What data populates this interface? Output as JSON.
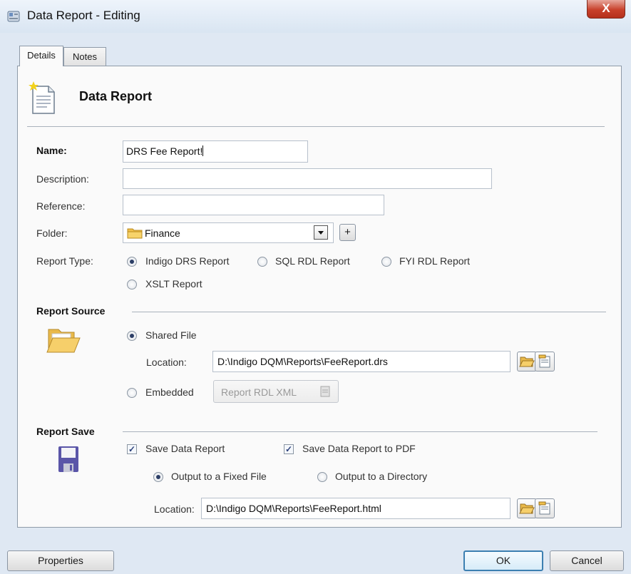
{
  "window": {
    "title": "Data Report - Editing",
    "close_glyph": "X"
  },
  "tabs": [
    {
      "label": "Details"
    },
    {
      "label": "Notes"
    }
  ],
  "header": {
    "title": "Data Report"
  },
  "fields": {
    "name_label": "Name:",
    "name_value": "DRS Fee Report!",
    "description_label": "Description:",
    "description_value": "",
    "reference_label": "Reference:",
    "reference_value": "",
    "folder_label": "Folder:",
    "folder_value": "Finance",
    "folder_add_label": "+"
  },
  "report_type": {
    "label": "Report Type:",
    "selected": "Indigo DRS Report",
    "options": [
      "Indigo DRS Report",
      "SQL RDL Report",
      "FYI RDL Report",
      "XSLT Report"
    ]
  },
  "report_source": {
    "title": "Report Source",
    "shared_file_label": "Shared File",
    "location_label": "Location:",
    "location_value": "D:\\Indigo DQM\\Reports\\FeeReport.drs",
    "embedded_label": "Embedded",
    "rdl_button_label": "Report RDL XML",
    "selected": "Shared File"
  },
  "report_save": {
    "title": "Report Save",
    "save_data_report_label": "Save Data Report",
    "save_data_report_checked": true,
    "save_pdf_label": "Save Data Report to PDF",
    "save_pdf_checked": true,
    "output_fixed_label": "Output to a Fixed File",
    "output_directory_label": "Output to a Directory",
    "output_selected": "Output to a Fixed File",
    "location_label": "Location:",
    "location_value": "D:\\Indigo DQM\\Reports\\FeeReport.html"
  },
  "footer": {
    "properties_label": "Properties",
    "ok_label": "OK",
    "cancel_label": "Cancel"
  },
  "colors": {
    "background": "#dfe8f3",
    "panel": "#fafafa",
    "close_button": "#c8412b",
    "folder_icon": "#f0c04a",
    "save_icon": "#5a55a8"
  }
}
